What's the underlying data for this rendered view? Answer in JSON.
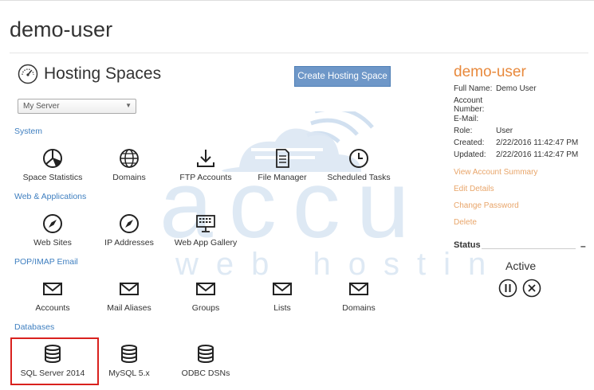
{
  "page": {
    "title": "demo-user"
  },
  "hosting": {
    "title": "Hosting Spaces",
    "create_button": "Create Hosting Space",
    "server_select": "My Server"
  },
  "sections": {
    "system": {
      "label": "System",
      "items": [
        {
          "label": "Space Statistics",
          "icon": "pie-chart-icon"
        },
        {
          "label": "Domains",
          "icon": "globe-icon"
        },
        {
          "label": "FTP Accounts",
          "icon": "download-icon"
        },
        {
          "label": "File Manager",
          "icon": "document-icon"
        },
        {
          "label": "Scheduled Tasks",
          "icon": "clock-icon"
        }
      ]
    },
    "web": {
      "label": "Web & Applications",
      "items": [
        {
          "label": "Web Sites",
          "icon": "compass-icon"
        },
        {
          "label": "IP Addresses",
          "icon": "compass-icon"
        },
        {
          "label": "Web App Gallery",
          "icon": "keyboard-icon"
        }
      ]
    },
    "mail": {
      "label": "POP/IMAP Email",
      "items": [
        {
          "label": "Accounts",
          "icon": "envelope-icon"
        },
        {
          "label": "Mail Aliases",
          "icon": "envelope-icon"
        },
        {
          "label": "Groups",
          "icon": "envelope-icon"
        },
        {
          "label": "Lists",
          "icon": "envelope-icon"
        },
        {
          "label": "Domains",
          "icon": "envelope-icon"
        }
      ]
    },
    "db": {
      "label": "Databases",
      "items": [
        {
          "label": "SQL Server 2014",
          "icon": "database-icon"
        },
        {
          "label": "MySQL 5.x",
          "icon": "database-icon"
        },
        {
          "label": "ODBC DSNs",
          "icon": "database-icon"
        }
      ]
    }
  },
  "account": {
    "name": "demo-user",
    "full_name_label": "Full Name:",
    "full_name": "Demo User",
    "account_number_label": "Account Number:",
    "email_label": "E-Mail:",
    "role_label": "Role:",
    "role": "User",
    "created_label": "Created:",
    "created": "2/22/2016 11:42:47 PM",
    "updated_label": "Updated:",
    "updated": "2/22/2016 11:42:47 PM",
    "links": {
      "summary": "View Account Summary",
      "edit": "Edit Details",
      "password": "Change Password",
      "delete": "Delete"
    },
    "status_label": "Status",
    "status_collapse": "–",
    "status_value": "Active"
  },
  "watermark": {
    "line1": "accu",
    "line2": "web hosting"
  },
  "colors": {
    "accent_orange": "#e8893c",
    "link_blue": "#3f7fc0",
    "button_blue": "#6e97c8",
    "highlight_red": "#d9211e"
  }
}
